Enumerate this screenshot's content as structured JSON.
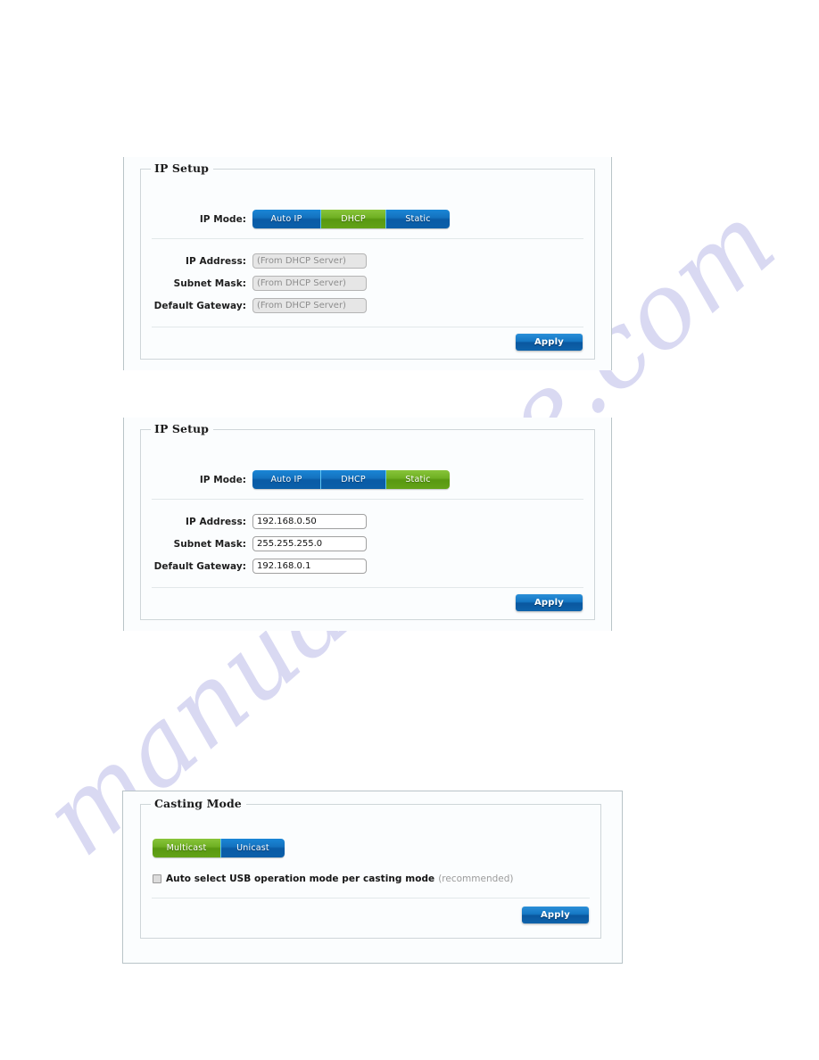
{
  "watermark": {
    "text": "manualshive.com"
  },
  "panels": [
    {
      "id": "ip-setup-dhcp",
      "legend": "IP Setup",
      "mode_label": "IP Mode:",
      "modes": [
        {
          "label": "Auto IP",
          "active": false
        },
        {
          "label": "DHCP",
          "active": true
        },
        {
          "label": "Static",
          "active": false
        }
      ],
      "fields": [
        {
          "label": "IP Address:",
          "value": "(From DHCP Server)",
          "disabled": true
        },
        {
          "label": "Subnet Mask:",
          "value": "(From DHCP Server)",
          "disabled": true
        },
        {
          "label": "Default Gateway:",
          "value": "(From DHCP Server)",
          "disabled": true
        }
      ],
      "apply_label": "Apply"
    },
    {
      "id": "ip-setup-static",
      "legend": "IP Setup",
      "mode_label": "IP Mode:",
      "modes": [
        {
          "label": "Auto IP",
          "active": false
        },
        {
          "label": "DHCP",
          "active": false
        },
        {
          "label": "Static",
          "active": true
        }
      ],
      "fields": [
        {
          "label": "IP Address:",
          "value": "192.168.0.50",
          "disabled": false
        },
        {
          "label": "Subnet Mask:",
          "value": "255.255.255.0",
          "disabled": false
        },
        {
          "label": "Default Gateway:",
          "value": "192.168.0.1",
          "disabled": false
        }
      ],
      "apply_label": "Apply"
    }
  ],
  "casting": {
    "legend": "Casting Mode",
    "modes": [
      {
        "label": "Multicast",
        "active": true
      },
      {
        "label": "Unicast",
        "active": false
      }
    ],
    "checkbox": {
      "checked": false,
      "label": "Auto select USB operation mode per casting mode",
      "hint": "(recommended)"
    },
    "apply_label": "Apply"
  },
  "colors": {
    "blue_button": "#0f6ab4",
    "green_active": "#6cae24",
    "panel_background": "#fbfdfe",
    "disabled_field": "#e6e6e6",
    "watermark": "#d8d8f2"
  }
}
